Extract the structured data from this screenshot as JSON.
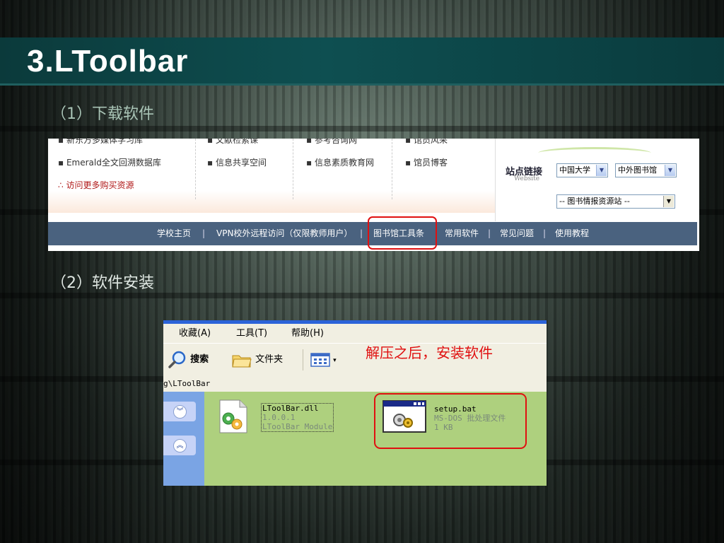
{
  "slide": {
    "title": "3.LToolbar",
    "step1": "（1）下载软件",
    "step2": "（2）软件安装"
  },
  "website": {
    "columns": [
      [
        "新东方多媒体学习库",
        "Emerald全文回溯数据库"
      ],
      [
        "文献检索课",
        "信息共享空间"
      ],
      [
        "参考咨询网",
        "信息素质教育网"
      ],
      [
        "馆员风采",
        "馆员博客"
      ]
    ],
    "more_link": "∴ 访问更多购买资源",
    "site_links_label": "站点链接",
    "site_links_sub": "Website",
    "select1": "中国大学",
    "select2": "中外图书馆",
    "select3": "-- 图书情报资源站 --",
    "nav_items": [
      "学校主页",
      "VPN校外远程访问（仅限教师用户）",
      "图书馆工具条",
      "常用软件",
      "常见问题",
      "使用教程"
    ],
    "nav_separator": "|"
  },
  "explorer": {
    "menu": [
      "收藏(A)",
      "工具(T)",
      "帮助(H)"
    ],
    "toolbar": {
      "search": "搜索",
      "folders": "文件夹"
    },
    "caption": "解压之后，安装软件",
    "address": "g\\LToolBar",
    "files": [
      {
        "name": "LToolBar.dll",
        "line2": "1.0.0.1",
        "line3": "LToolBar Module"
      },
      {
        "name": "setup.bat",
        "line2": "MS-DOS 批处理文件",
        "line3": "1 KB"
      }
    ]
  },
  "colors": {
    "title_bar": "#0e4f51",
    "highlight": "#e01010",
    "nav_bg": "#4a627f",
    "explorer_bg": "#aed07e"
  }
}
